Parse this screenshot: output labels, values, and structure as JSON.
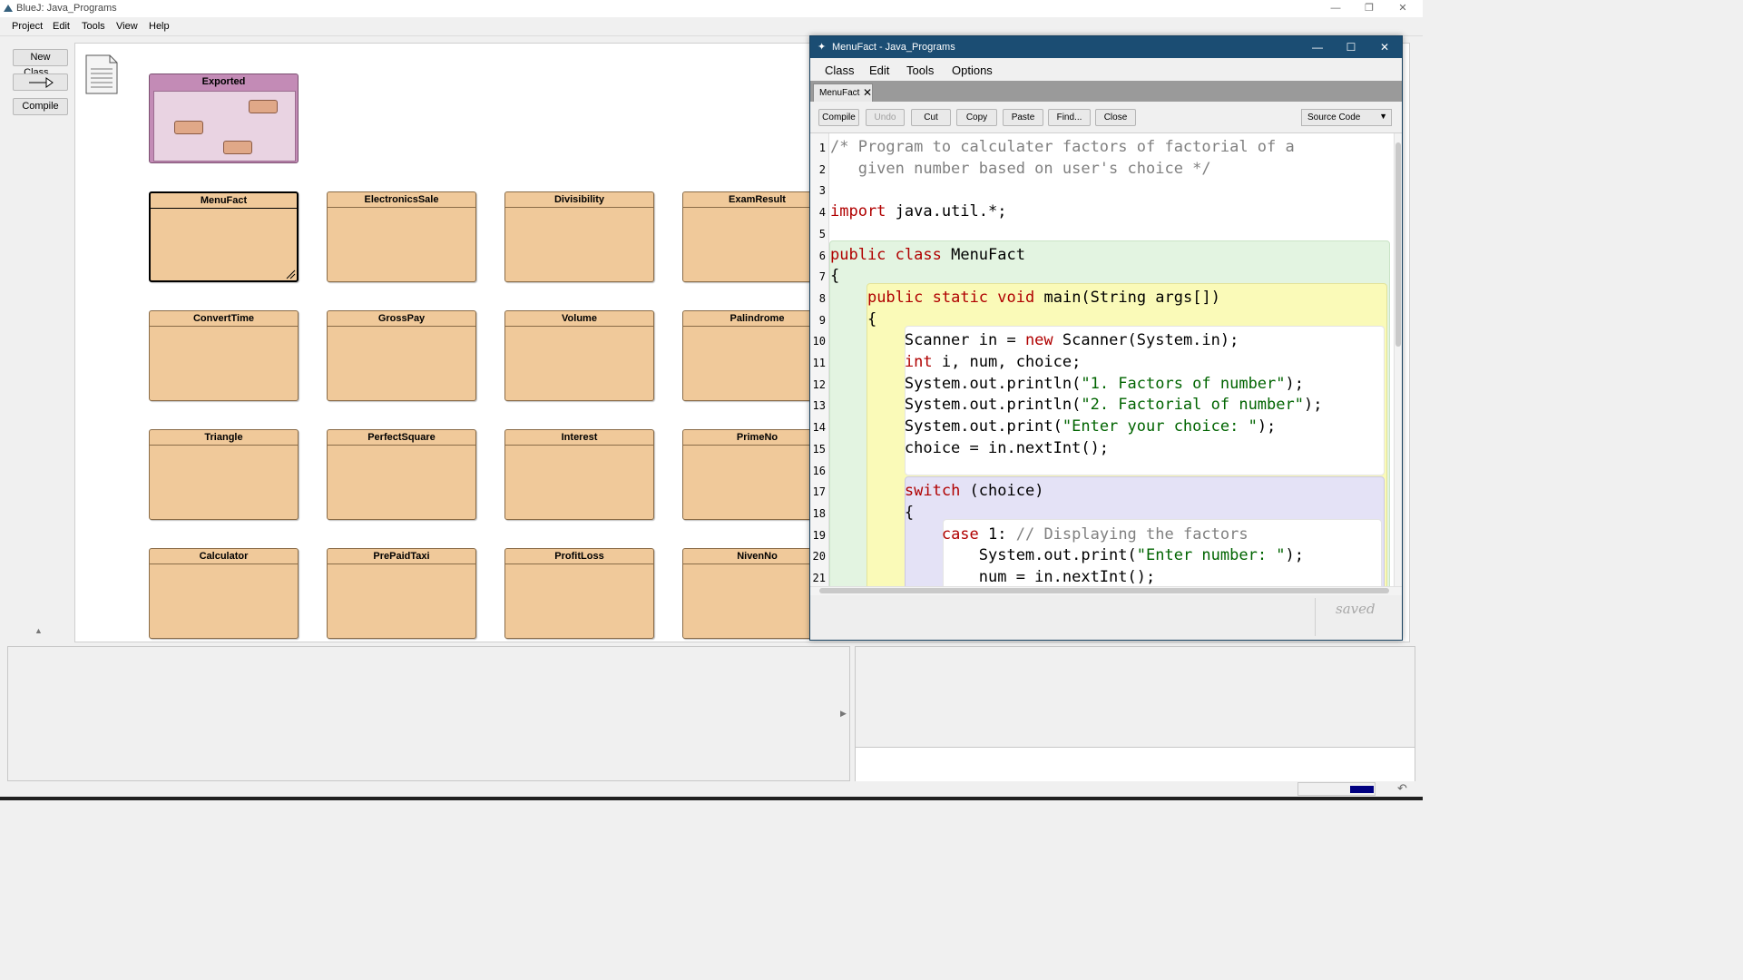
{
  "main_window": {
    "title": "BlueJ: Java_Programs",
    "menu": [
      "Project",
      "Edit",
      "Tools",
      "View",
      "Help"
    ],
    "side_buttons": {
      "new_class": "New Class...",
      "arrow": "—▷",
      "compile": "Compile"
    }
  },
  "package": {
    "name": "Exported"
  },
  "classes": [
    "MenuFact",
    "ElectronicsSale",
    "Divisibility",
    "ExamResult",
    "ConvertTime",
    "GrossPay",
    "Volume",
    "Palindrome",
    "Triangle",
    "PerfectSquare",
    "Interest",
    "PrimeNo",
    "Calculator",
    "PrePaidTaxi",
    "ProfitLoss",
    "NivenNo"
  ],
  "editor": {
    "title": "MenuFact - Java_Programs",
    "menu": [
      "Class",
      "Edit",
      "Tools",
      "Options"
    ],
    "tab": "MenuFact",
    "toolbar": {
      "compile": "Compile",
      "undo": "Undo",
      "cut": "Cut",
      "copy": "Copy",
      "paste": "Paste",
      "find": "Find...",
      "close": "Close"
    },
    "view_select": "Source Code",
    "status": "saved",
    "line_numbers": [
      "1",
      "2",
      "3",
      "4",
      "5",
      "6",
      "7",
      "8",
      "9",
      "10",
      "11",
      "12",
      "13",
      "14",
      "15",
      "16",
      "17",
      "18",
      "19",
      "20",
      "21"
    ],
    "code_lines": [
      "/* Program to calculater factors of factorial of a",
      "   given number based on user's choice */",
      "",
      "import java.util.*;",
      "",
      "public class MenuFact",
      "{",
      "    public static void main(String args[])",
      "    {",
      "        Scanner in = new Scanner(System.in);",
      "        int i, num, choice;",
      "        System.out.println(\"1. Factors of number\");",
      "        System.out.println(\"2. Factorial of number\");",
      "        System.out.print(\"Enter your choice: \");",
      "        choice = in.nextInt();",
      "",
      "        switch (choice)",
      "        {",
      "            case 1: // Displaying the factors",
      "                System.out.print(\"Enter number: \");",
      "                num = in.nextInt();"
    ]
  }
}
